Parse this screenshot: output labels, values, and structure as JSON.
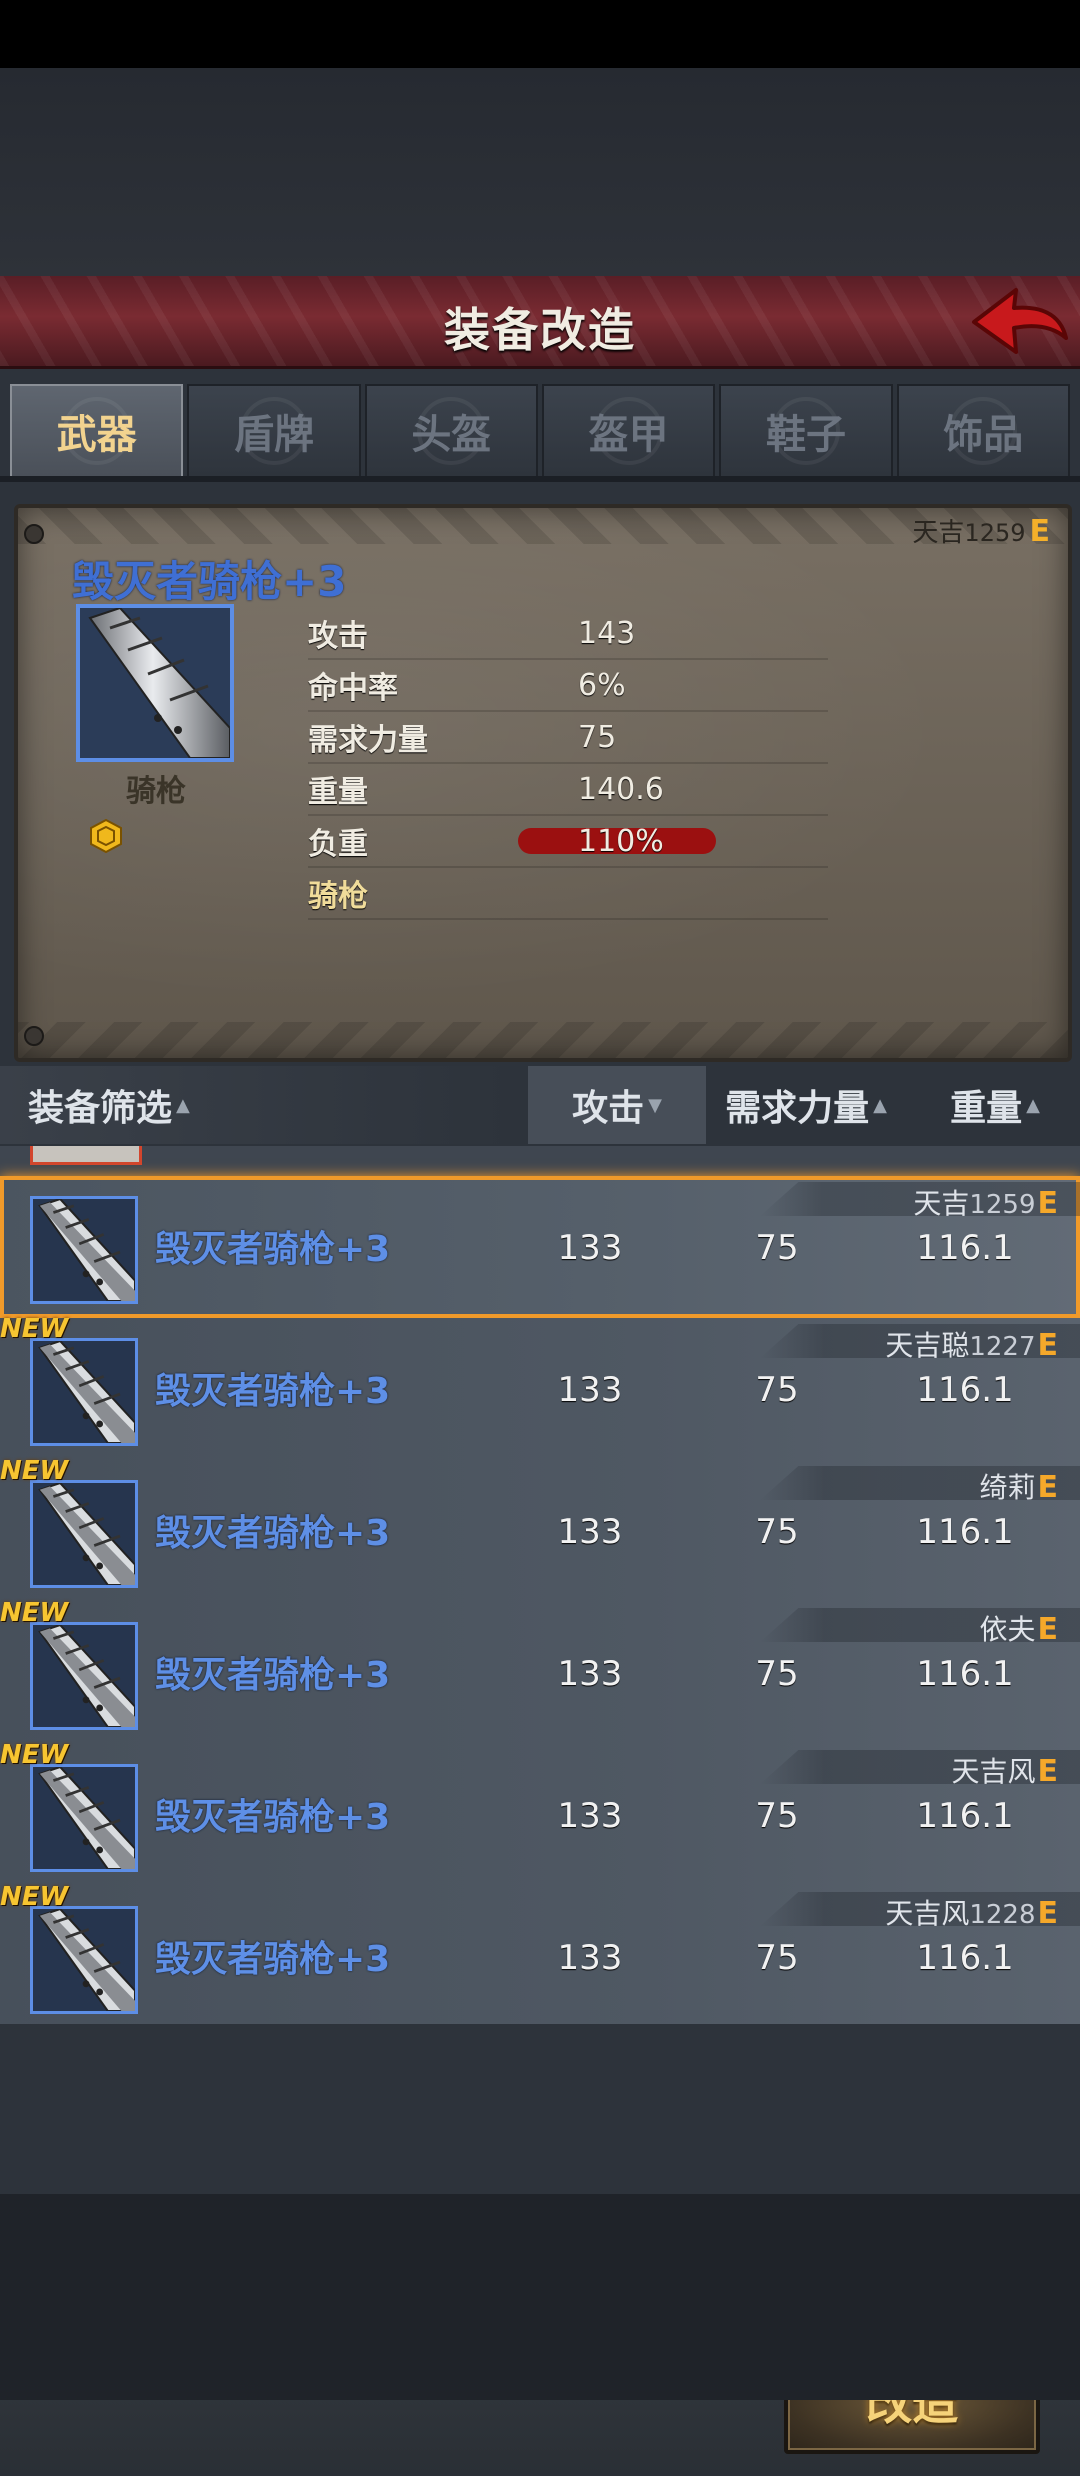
{
  "header": {
    "title": "装备改造"
  },
  "tabs": [
    {
      "label": "武器",
      "active": true
    },
    {
      "label": "盾牌",
      "active": false
    },
    {
      "label": "头盔",
      "active": false
    },
    {
      "label": "盔甲",
      "active": false
    },
    {
      "label": "鞋子",
      "active": false
    },
    {
      "label": "饰品",
      "active": false
    }
  ],
  "detail": {
    "owner_name": "天吉",
    "owner_num": "1259",
    "equip_mark": "E",
    "item_name": "毁灭者骑枪+3",
    "item_type": "骑枪",
    "stats": [
      {
        "label": "攻击",
        "value": "143"
      },
      {
        "label": "命中率",
        "value": "6%"
      },
      {
        "label": "需求力量",
        "value": "75"
      },
      {
        "label": "重量",
        "value": "140.6"
      },
      {
        "label": "负重",
        "value": "110%"
      }
    ],
    "weapon_class": "骑枪"
  },
  "filter": {
    "label": "装备筛选",
    "sort_attack": "攻击",
    "sort_strength": "需求力量",
    "sort_weight": "重量"
  },
  "list": [
    {
      "name": "毁灭者骑枪+3",
      "attack": "133",
      "strength": "75",
      "weight": "116.1",
      "owner": "天吉",
      "owner_num": "1259",
      "mark": "E",
      "is_new": false,
      "selected": true
    },
    {
      "name": "毁灭者骑枪+3",
      "attack": "133",
      "strength": "75",
      "weight": "116.1",
      "owner": "天吉聪",
      "owner_num": "1227",
      "mark": "E",
      "is_new": true,
      "new_label": "NEW",
      "selected": false
    },
    {
      "name": "毁灭者骑枪+3",
      "attack": "133",
      "strength": "75",
      "weight": "116.1",
      "owner": "绮莉",
      "owner_num": "",
      "mark": "E",
      "is_new": true,
      "new_label": "NEW",
      "selected": false
    },
    {
      "name": "毁灭者骑枪+3",
      "attack": "133",
      "strength": "75",
      "weight": "116.1",
      "owner": "依夫",
      "owner_num": "",
      "mark": "E",
      "is_new": true,
      "new_label": "NEW",
      "selected": false
    },
    {
      "name": "毁灭者骑枪+3",
      "attack": "133",
      "strength": "75",
      "weight": "116.1",
      "owner": "天吉风",
      "owner_num": "",
      "mark": "E",
      "is_new": true,
      "new_label": "NEW",
      "selected": false
    },
    {
      "name": "毁灭者骑枪+3",
      "attack": "133",
      "strength": "75",
      "weight": "116.1",
      "owner": "天吉风",
      "owner_num": "1228",
      "mark": "E",
      "is_new": true,
      "new_label": "NEW",
      "selected": false
    }
  ],
  "actions": {
    "modify_label": "改造"
  },
  "colors": {
    "accent_gold": "#f5b02a",
    "item_name_blue": "#5e8fe6",
    "selected_border": "#f09a2a",
    "header_red": "#7a2b32"
  }
}
